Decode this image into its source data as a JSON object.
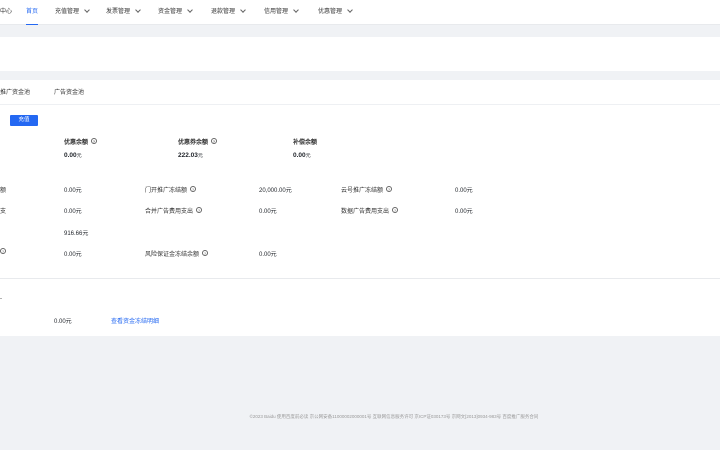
{
  "nav": {
    "items": [
      {
        "label": "中心",
        "dropdown": false,
        "active": false
      },
      {
        "label": "首页",
        "dropdown": false,
        "active": true
      },
      {
        "label": "充值管理",
        "dropdown": true,
        "active": false
      },
      {
        "label": "发票管理",
        "dropdown": true,
        "active": false
      },
      {
        "label": "资金管理",
        "dropdown": true,
        "active": false
      },
      {
        "label": "退款管理",
        "dropdown": true,
        "active": false
      },
      {
        "label": "信用管理",
        "dropdown": true,
        "active": false
      },
      {
        "label": "优惠管理",
        "dropdown": true,
        "active": false
      }
    ]
  },
  "tabs": [
    "推广资金池",
    "广告资金池"
  ],
  "recharge_button": "充值",
  "summary": {
    "coupon_balance_label": "优惠余额",
    "coupon_balance_value": "0.00",
    "coupon_balance_unit": "元",
    "discount_balance_label": "优惠券余额",
    "discount_balance_value": "222.03",
    "discount_balance_unit": "元",
    "compensation_balance_label": "补偿余额",
    "compensation_balance_value": "0.00",
    "compensation_balance_unit": "元"
  },
  "details": {
    "row1": {
      "left_label": "额",
      "left_value": "0.00元",
      "mid_label": "门开推广冻结额",
      "mid_value": "20,000.00元",
      "right_label": "云号推广冻结额",
      "right_value": "0.00元"
    },
    "row2": {
      "left_label": "支",
      "left_value": "0.00元",
      "mid_label": "合并广告费用支出",
      "mid_value": "0.00元",
      "right_label": "数据广告费用支出",
      "right_value": "0.00元"
    },
    "row3": {
      "left_value": "916.66元"
    },
    "row4": {
      "left_value": "0.00元",
      "mid_label": "风险保证金冻结余额",
      "mid_value": "0.00元"
    }
  },
  "bottom": {
    "left_label": "-",
    "left_value": "0.00元",
    "link": "查看资金冻结明细"
  },
  "footer": "©2023 Baidu 使用百度前必读 京公网安备11000002000001号 互联网信息服务许可 京ICP证030173号 京网文[2013]0934-983号 百度推广服务合同"
}
